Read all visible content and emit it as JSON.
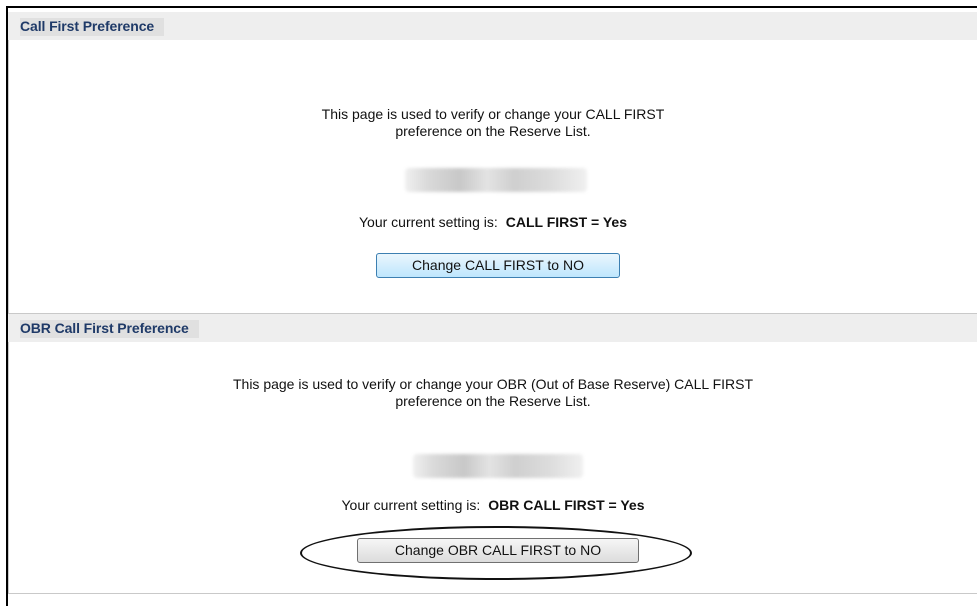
{
  "call_first": {
    "header_title": "Call First Preference",
    "description_line1": "This page is used to verify or change your CALL FIRST",
    "description_line2": "preference on the Reserve List.",
    "setting_label": "Your current setting is:",
    "setting_value": "CALL FIRST = Yes",
    "button_label": "Change CALL FIRST to NO"
  },
  "obr_call_first": {
    "header_title": "OBR Call First Preference",
    "description_line1": "This page is used to verify or change your OBR (Out of Base Reserve) CALL FIRST",
    "description_line2": "preference on the Reserve List.",
    "setting_label": "Your current setting is:",
    "setting_value": "OBR CALL FIRST = Yes",
    "button_label": "Change OBR CALL FIRST to NO"
  }
}
